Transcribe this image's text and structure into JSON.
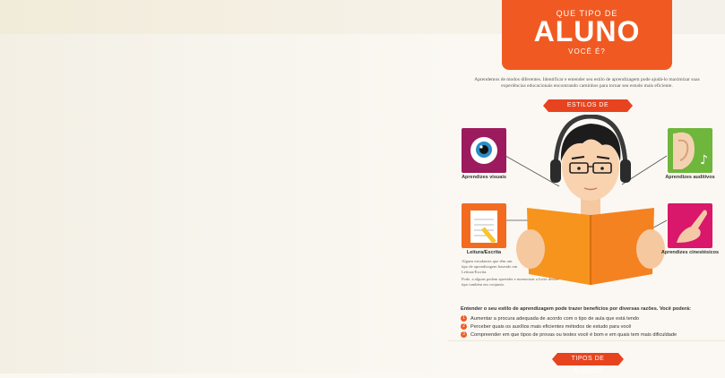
{
  "header": {
    "pre": "QUE TIPO DE",
    "title": "ALUNO",
    "post": "VOCÊ É?"
  },
  "intro": {
    "text": "Aprendemos de modos diferentes. Identificar e entender seu estilo de aprendizagem pode ajudá-lo maximizar suas experiências educacionais encontrando caminhos para tornar seu estudo mais eficiente."
  },
  "section1": {
    "ribbon": "ESTILOS DE APRENDIZAGEM"
  },
  "styles": {
    "visual": "Aprendizes visuais",
    "auditory": "Aprendizes auditivos",
    "reading": "Leitura/Escrita",
    "kinesthetic": "Aprendizes cinestésicos"
  },
  "reading_desc": {
    "p1": "Alguns estudantes que têm um tipo de aprendizagem baseado em Leitura/Escrita.",
    "p2": "Pode, a alguns podem aprender e memorizar a lover desses tipo também em conjunto."
  },
  "benefits": {
    "lead": "Entender o seu estilo de aprendizagem pode trazer benefícios por diversas razões. Você poderá:",
    "items": [
      {
        "n": "1",
        "text": "Aumentar a procura adequada de acordo com o tipo de aula que está tendo"
      },
      {
        "n": "2",
        "text": "Perceber quais os auxílios mais eficientes métodos de estudo para você"
      },
      {
        "n": "3",
        "text": "Compreender em que tipos de provas ou testes você é bom e em quais tem mais dificuldade"
      }
    ]
  },
  "section2": {
    "ribbon": "TIPOS DE ALUNOS"
  },
  "colors": {
    "accent": "#f05a22",
    "ribbon": "#e8431f",
    "visual_tile": "#9c1b5e",
    "auditory_tile": "#6fb63c",
    "kinesthetic_tile": "#d9176b",
    "reading_tile": "#f36b20",
    "book": "#f7941d"
  }
}
